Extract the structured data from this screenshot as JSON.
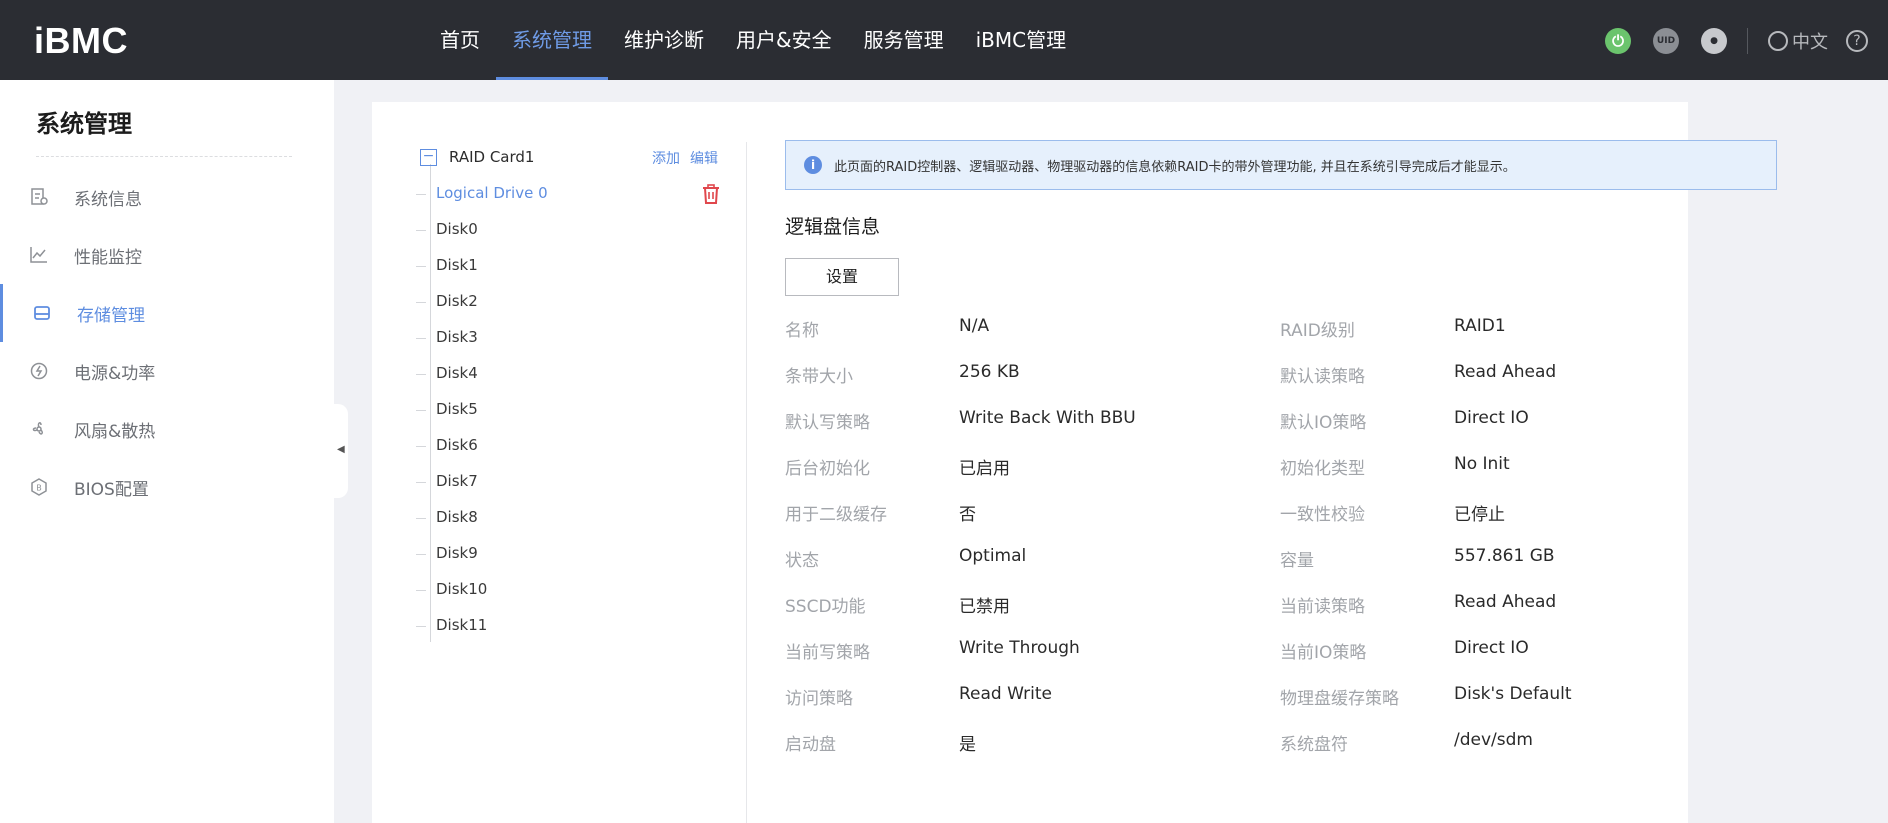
{
  "app": {
    "logo": "iBMC"
  },
  "nav": {
    "items": [
      "首页",
      "系统管理",
      "维护诊断",
      "用户&安全",
      "服务管理",
      "iBMC管理"
    ],
    "active_index": 1
  },
  "topbar": {
    "uid_label": "UID",
    "language": "中文",
    "help_symbol": "?"
  },
  "sidebar": {
    "title": "系统管理",
    "items": [
      {
        "label": "系统信息",
        "icon": "system-info-icon"
      },
      {
        "label": "性能监控",
        "icon": "chart-line-icon"
      },
      {
        "label": "存储管理",
        "icon": "storage-icon"
      },
      {
        "label": "电源&功率",
        "icon": "power-lightning-icon"
      },
      {
        "label": "风扇&散热",
        "icon": "fan-icon"
      },
      {
        "label": "BIOS配置",
        "icon": "bios-icon"
      }
    ],
    "active_index": 2
  },
  "tree": {
    "root": "RAID Card1",
    "actions": {
      "add": "添加",
      "edit": "编辑"
    },
    "nodes": [
      "Logical Drive 0",
      "Disk0",
      "Disk1",
      "Disk2",
      "Disk3",
      "Disk4",
      "Disk5",
      "Disk6",
      "Disk7",
      "Disk8",
      "Disk9",
      "Disk10",
      "Disk11"
    ],
    "selected_index": 0
  },
  "notice": "此页面的RAID控制器、逻辑驱动器、物理驱动器的信息依赖RAID卡的带外管理功能, 并且在系统引导完成后才能显示。",
  "section": {
    "title": "逻辑盘信息",
    "set_button": "设置"
  },
  "properties": {
    "left": [
      {
        "key": "名称",
        "value": "N/A"
      },
      {
        "key": "条带大小",
        "value": "256 KB"
      },
      {
        "key": "默认写策略",
        "value": "Write Back With BBU"
      },
      {
        "key": "后台初始化",
        "value": "已启用"
      },
      {
        "key": "用于二级缓存",
        "value": "否"
      },
      {
        "key": "状态",
        "value": "Optimal"
      },
      {
        "key": "SSCD功能",
        "value": "已禁用"
      },
      {
        "key": "当前写策略",
        "value": "Write Through"
      },
      {
        "key": "访问策略",
        "value": "Read Write"
      },
      {
        "key": "启动盘",
        "value": "是"
      }
    ],
    "right": [
      {
        "key": "RAID级别",
        "value": "RAID1"
      },
      {
        "key": "默认读策略",
        "value": "Read Ahead"
      },
      {
        "key": "默认IO策略",
        "value": "Direct IO"
      },
      {
        "key": "初始化类型",
        "value": "No Init"
      },
      {
        "key": "一致性校验",
        "value": "已停止"
      },
      {
        "key": "容量",
        "value": "557.861 GB"
      },
      {
        "key": "当前读策略",
        "value": "Read Ahead"
      },
      {
        "key": "当前IO策略",
        "value": "Direct IO"
      },
      {
        "key": "物理盘缓存策略",
        "value": "Disk's Default"
      },
      {
        "key": "系统盘符",
        "value": "/dev/sdm"
      }
    ]
  },
  "colors": {
    "accent": "#5e8de0",
    "topbar": "#2b2d33",
    "power": "#6bc46d",
    "danger": "#e0474c"
  }
}
